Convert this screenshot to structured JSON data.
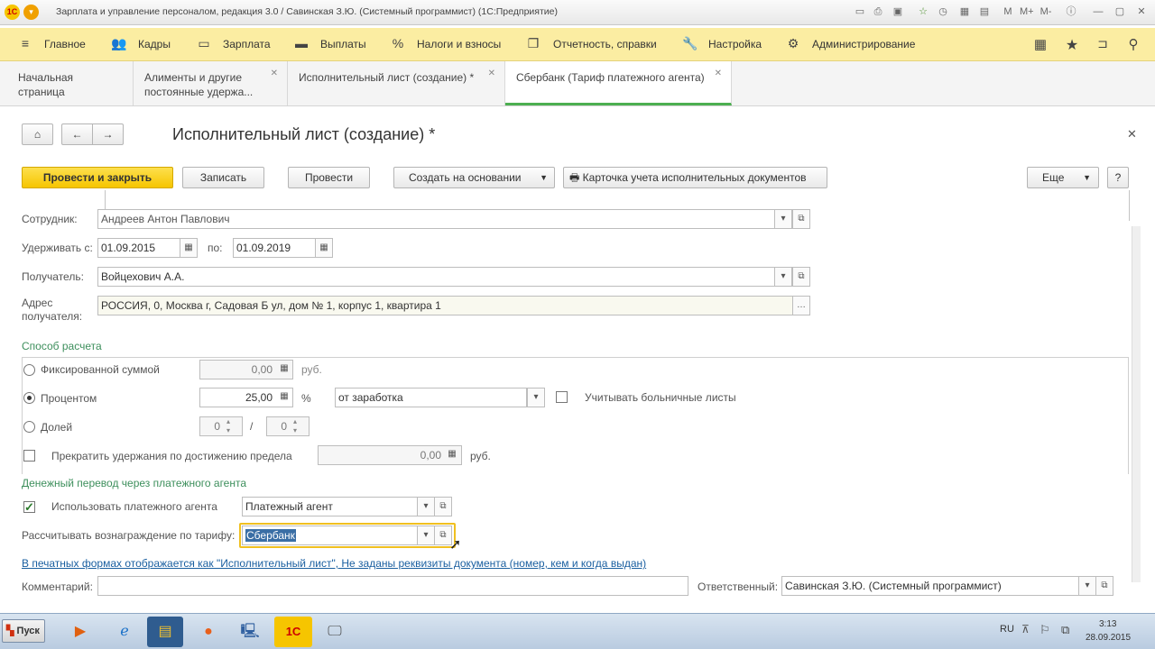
{
  "window": {
    "title": "Зарплата и управление персоналом, редакция 3.0 / Савинская З.Ю. (Системный программист)  (1С:Предприятие)"
  },
  "menu": {
    "items": [
      {
        "label": "Главное",
        "icon": "hamburger-icon"
      },
      {
        "label": "Кадры",
        "icon": "people-icon"
      },
      {
        "label": "Зарплата",
        "icon": "wallet-icon"
      },
      {
        "label": "Выплаты",
        "icon": "payments-icon"
      },
      {
        "label": "Налоги и взносы",
        "icon": "percent-icon"
      },
      {
        "label": "Отчетность, справки",
        "icon": "report-icon"
      },
      {
        "label": "Настройка",
        "icon": "wrench-icon"
      },
      {
        "label": "Администрирование",
        "icon": "gear-icon"
      }
    ]
  },
  "tabs": [
    {
      "label": "Начальная страница"
    },
    {
      "label": "Алименты и другие постоянные удержа..."
    },
    {
      "label": "Исполнительный лист (создание) *"
    },
    {
      "label": "Сбербанк (Тариф платежного агента)"
    }
  ],
  "form": {
    "title": "Исполнительный лист (создание) *",
    "buttons": {
      "post_close": "Провести и закрыть",
      "save": "Записать",
      "post": "Провести",
      "create_based": "Создать на основании",
      "card": "Карточка учета исполнительных документов",
      "more": "Еще",
      "help": "?"
    },
    "employee": {
      "label": "Сотрудник:",
      "value": "Андреев Антон Павлович"
    },
    "withhold": {
      "from_label": "Удерживать с:",
      "from": "01.09.2015",
      "to_label": "по:",
      "to": "01.09.2019"
    },
    "recipient": {
      "label": "Получатель:",
      "value": "Войцехович А.А."
    },
    "address": {
      "label1": "Адрес",
      "label2": "получателя:",
      "value": "РОССИЯ, 0, Москва г, Садовая Б ул, дом № 1, корпус 1, квартира 1"
    },
    "calc": {
      "section": "Способ расчета",
      "fixed_label": "Фиксированной суммой",
      "fixed_value": "0,00",
      "fixed_unit": "руб.",
      "percent_label": "Процентом",
      "percent_value": "25,00",
      "percent_unit": "%",
      "base_value": "от заработка",
      "sick_label": "Учитывать больничные листы",
      "share_label": "Долей",
      "share_num": "0",
      "share_sep": "/",
      "share_den": "0",
      "limit_label": "Прекратить удержания по достижению предела",
      "limit_value": "0,00",
      "limit_unit": "руб."
    },
    "agent": {
      "section": "Денежный перевод через платежного агента",
      "use_label": "Использовать платежного агента",
      "agent_value": "Платежный агент",
      "tariff_label": "Рассчитывать вознаграждение по тарифу:",
      "tariff_value": "Сбербанк"
    },
    "print_link": "В печатных формах отображается как \"Исполнительный лист\", Не заданы реквизиты документа (номер, кем и когда выдан)",
    "comment_label": "Комментарий:",
    "responsible": {
      "label": "Ответственный:",
      "value": "Савинская З.Ю. (Системный программист)"
    }
  },
  "taskbar": {
    "start": "Пуск",
    "lang": "RU",
    "time": "3:13",
    "date": "28.09.2015"
  },
  "colors": {
    "menu_bg": "#fbeda2",
    "primary_btn": "#f6c500",
    "section_green": "#3d8f5c",
    "link": "#1a5fa0",
    "tab_active": "#4caf50"
  }
}
